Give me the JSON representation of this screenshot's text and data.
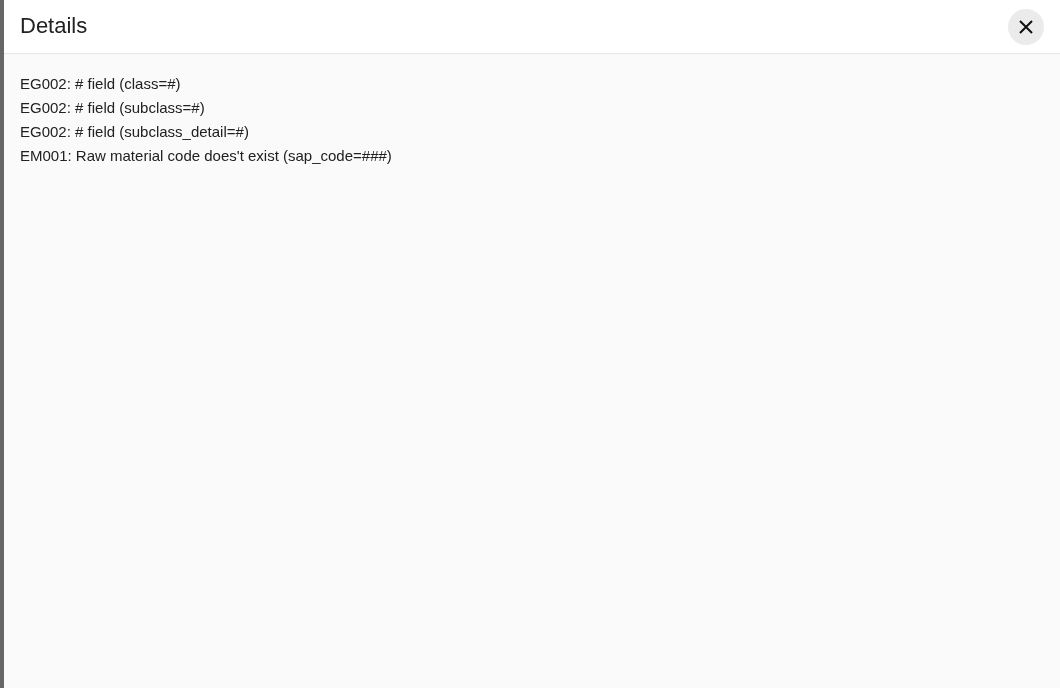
{
  "dialog": {
    "title": "Details",
    "messages": [
      "EG002: # field (class=#)",
      "EG002: # field (subclass=#)",
      "EG002: # field (subclass_detail=#)",
      "EM001: Raw material code does't exist (sap_code=###)"
    ]
  }
}
